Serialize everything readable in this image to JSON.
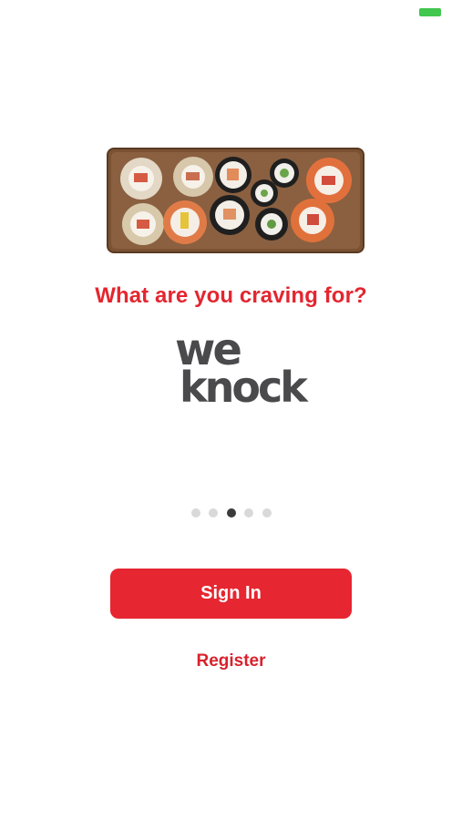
{
  "onboarding": {
    "headline": "What are you craving for?",
    "logo": {
      "line1": "we",
      "line2": "knock"
    },
    "carousel": {
      "total": 5,
      "active_index": 3
    }
  },
  "actions": {
    "sign_in_label": "Sign In",
    "register_label": "Register"
  },
  "colors": {
    "brand_red": "#e62630",
    "logo_gray": "#4a4a4d",
    "dot_active": "#3b3b3b",
    "dot_inactive": "#d9d9d9",
    "battery_green": "#41c64e"
  },
  "icons": {
    "status_battery": "battery-icon",
    "hero_image": "sushi-platter-image"
  }
}
